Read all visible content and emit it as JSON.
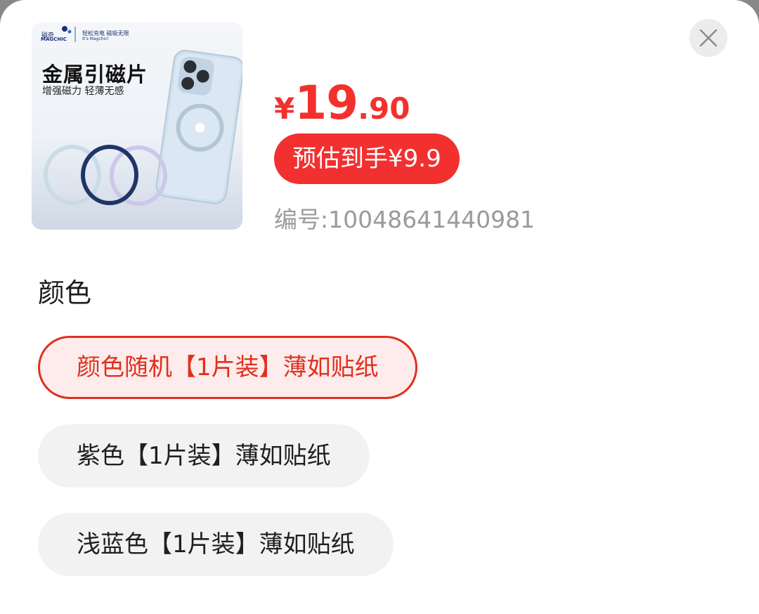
{
  "product": {
    "image": {
      "brand_zh": "磁奇",
      "brand_en": "MAGCHIC",
      "slogan": "轻松充电 磁吸无限",
      "slogan_en": "It's Magchic!",
      "headline": "金属引磁片",
      "subline": "增强磁力 轻薄无感"
    },
    "price": {
      "currency": "¥",
      "integer": "19",
      "decimal": ".90"
    },
    "estimated_label": "预估到手¥9.9",
    "sku_label": "编号:10048641440981"
  },
  "section": {
    "color_label": "颜色"
  },
  "options": [
    {
      "label": "颜色随机【1片装】薄如贴纸",
      "selected": true
    },
    {
      "label": "紫色【1片装】薄如贴纸",
      "selected": false
    },
    {
      "label": "浅蓝色【1片装】薄如贴纸",
      "selected": false
    }
  ],
  "colors": {
    "accent": "#f2312d",
    "selected_border": "#e0301e",
    "selected_bg": "#fdeceb",
    "option_bg": "#f2f2f2",
    "muted_text": "#9a9a9a"
  },
  "icons": {
    "close": "close-icon"
  }
}
